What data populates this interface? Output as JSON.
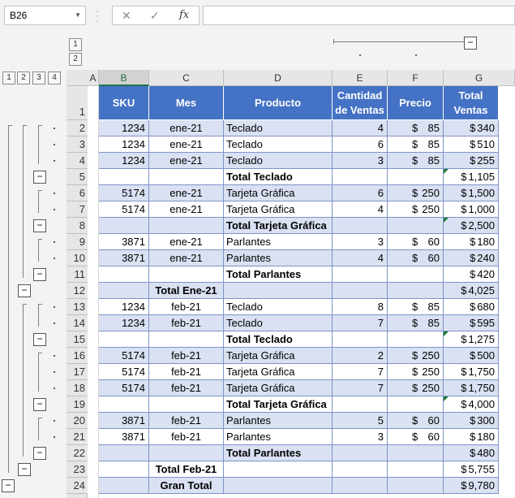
{
  "formula_bar": {
    "name_box": "B26",
    "cancel_icon": "✕",
    "enter_icon": "✓",
    "fx_label": "fx",
    "formula": ""
  },
  "outline": {
    "column_levels": [
      "1",
      "2"
    ],
    "row_levels": [
      "1",
      "2",
      "3",
      "4"
    ],
    "collapse_glyph": "−"
  },
  "column_headers": [
    "A",
    "B",
    "C",
    "D",
    "E",
    "F",
    "G"
  ],
  "table": {
    "header_row_number": "1",
    "headers": [
      "SKU",
      "Mes",
      "Producto",
      "Cantidad de Ventas",
      "Precio",
      "Total Ventas"
    ],
    "header_lines": {
      "cantidad": [
        "Cantidad",
        "de Ventas"
      ],
      "total": [
        "Total",
        "Ventas"
      ]
    },
    "rows": [
      {
        "n": "2",
        "sku": "1234",
        "mes": "ene-21",
        "producto": "Teclado",
        "cantidad": "4",
        "precio": "85",
        "total": "340"
      },
      {
        "n": "3",
        "sku": "1234",
        "mes": "ene-21",
        "producto": "Teclado",
        "cantidad": "6",
        "precio": "85",
        "total": "510"
      },
      {
        "n": "4",
        "sku": "1234",
        "mes": "ene-21",
        "producto": "Teclado",
        "cantidad": "3",
        "precio": "85",
        "total": "255"
      },
      {
        "n": "5",
        "sku": "",
        "mes": "",
        "producto": "Total Teclado",
        "cantidad": "",
        "precio": "",
        "total": "1,105"
      },
      {
        "n": "6",
        "sku": "5174",
        "mes": "ene-21",
        "producto": "Tarjeta Gráfica",
        "cantidad": "6",
        "precio": "250",
        "total": "1,500"
      },
      {
        "n": "7",
        "sku": "5174",
        "mes": "ene-21",
        "producto": "Tarjeta Gráfica",
        "cantidad": "4",
        "precio": "250",
        "total": "1,000"
      },
      {
        "n": "8",
        "sku": "",
        "mes": "",
        "producto": "Total Tarjeta Gráfica",
        "cantidad": "",
        "precio": "",
        "total": "2,500"
      },
      {
        "n": "9",
        "sku": "3871",
        "mes": "ene-21",
        "producto": "Parlantes",
        "cantidad": "3",
        "precio": "60",
        "total": "180"
      },
      {
        "n": "10",
        "sku": "3871",
        "mes": "ene-21",
        "producto": "Parlantes",
        "cantidad": "4",
        "precio": "60",
        "total": "240"
      },
      {
        "n": "11",
        "sku": "",
        "mes": "",
        "producto": "Total Parlantes",
        "cantidad": "",
        "precio": "",
        "total": "420"
      },
      {
        "n": "12",
        "sku": "",
        "mes": "Total Ene-21",
        "producto": "",
        "cantidad": "",
        "precio": "",
        "total": "4,025"
      },
      {
        "n": "13",
        "sku": "1234",
        "mes": "feb-21",
        "producto": "Teclado",
        "cantidad": "8",
        "precio": "85",
        "total": "680"
      },
      {
        "n": "14",
        "sku": "1234",
        "mes": "feb-21",
        "producto": "Teclado",
        "cantidad": "7",
        "precio": "85",
        "total": "595"
      },
      {
        "n": "15",
        "sku": "",
        "mes": "",
        "producto": "Total Teclado",
        "cantidad": "",
        "precio": "",
        "total": "1,275"
      },
      {
        "n": "16",
        "sku": "5174",
        "mes": "feb-21",
        "producto": "Tarjeta Gráfica",
        "cantidad": "2",
        "precio": "250",
        "total": "500"
      },
      {
        "n": "17",
        "sku": "5174",
        "mes": "feb-21",
        "producto": "Tarjeta Gráfica",
        "cantidad": "7",
        "precio": "250",
        "total": "1,750"
      },
      {
        "n": "18",
        "sku": "5174",
        "mes": "feb-21",
        "producto": "Tarjeta Gráfica",
        "cantidad": "7",
        "precio": "250",
        "total": "1,750"
      },
      {
        "n": "19",
        "sku": "",
        "mes": "",
        "producto": "Total Tarjeta Gráfica",
        "cantidad": "",
        "precio": "",
        "total": "4,000"
      },
      {
        "n": "20",
        "sku": "3871",
        "mes": "feb-21",
        "producto": "Parlantes",
        "cantidad": "5",
        "precio": "60",
        "total": "300"
      },
      {
        "n": "21",
        "sku": "3871",
        "mes": "feb-21",
        "producto": "Parlantes",
        "cantidad": "3",
        "precio": "60",
        "total": "180"
      },
      {
        "n": "22",
        "sku": "",
        "mes": "",
        "producto": "Total Parlantes",
        "cantidad": "",
        "precio": "",
        "total": "480"
      },
      {
        "n": "23",
        "sku": "",
        "mes": "Total Feb-21",
        "producto": "",
        "cantidad": "",
        "precio": "",
        "total": "5,755"
      },
      {
        "n": "24",
        "sku": "",
        "mes": "Gran Total",
        "producto": "",
        "cantidad": "",
        "precio": "",
        "total": "9,780"
      }
    ],
    "currency_symbol": "$"
  },
  "colors": {
    "header_fill": "#4472c4",
    "band_fill": "#d9e1f2",
    "selected_column": "#217346",
    "error_indicator": "#1e7b3a"
  }
}
